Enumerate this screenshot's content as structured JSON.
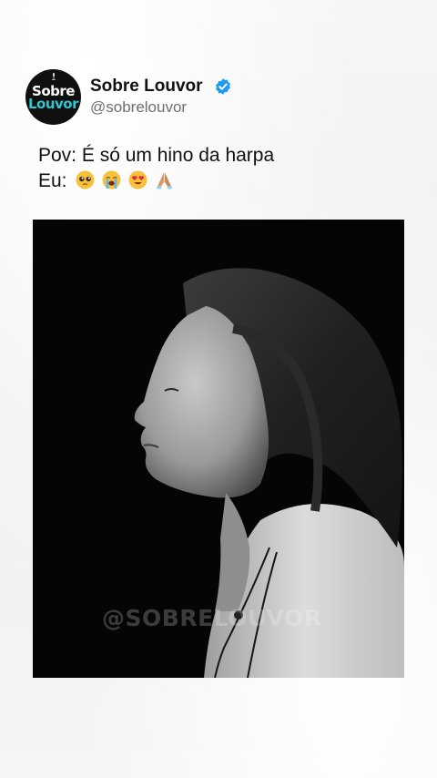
{
  "profile": {
    "avatar_text_line1": "Sobre",
    "avatar_text_line2": "Louvor",
    "display_name": "Sobre Louvor",
    "handle": "@sobrelouvor",
    "verified": true
  },
  "caption": {
    "line1": "Pov: É só um hino da harpa",
    "line2_prefix": "Eu:",
    "emojis": [
      "pleading-face",
      "loudly-crying-face",
      "heart-eyes-face",
      "folded-hands"
    ]
  },
  "media": {
    "watermark": "@SOBRELOUVOR"
  },
  "colors": {
    "accent": "#1d9bf0",
    "avatar_bg": "#101010",
    "avatar_teal": "#2ec6d0",
    "background": "#f3f3f3",
    "text": "#111111",
    "handle": "#6b6f73"
  }
}
